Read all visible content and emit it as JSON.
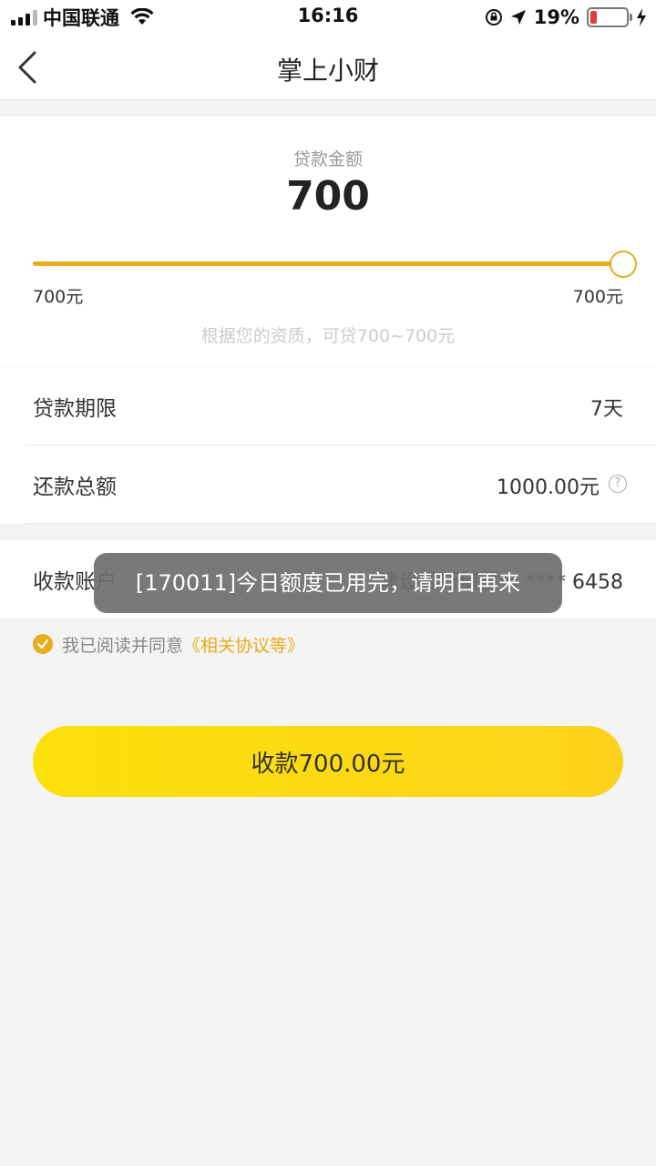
{
  "status_bar": {
    "carrier": "中国联通",
    "time": "16:16",
    "battery_percent": "19%",
    "battery_level": 0.19,
    "battery_color": "#e23b3b"
  },
  "nav": {
    "back_icon": "chevron-left-icon",
    "title": "掌上小财"
  },
  "loan": {
    "amount_label": "贷款金额",
    "amount_value": "700",
    "slider_min_label": "700元",
    "slider_max_label": "700元",
    "slider_fraction": 1.0,
    "quota_hint": "根据您的资质，可贷700~700元"
  },
  "term_row": {
    "label": "贷款期限",
    "value": "7天"
  },
  "total_row": {
    "label": "还款总额",
    "value": "1000.00元",
    "help_icon": "question-circle-icon",
    "help_glyph": "?"
  },
  "account_row": {
    "label": "收款账户",
    "value": "建设银行储蓄卡 **** 6458"
  },
  "agreement": {
    "check_icon": "check-circle-icon",
    "text": "我已阅读并同意",
    "link": "《相关协议等》"
  },
  "submit": {
    "label": "收款700.00元"
  },
  "toast": {
    "message": "[170011]今日额度已用完，请明日再来"
  },
  "colors": {
    "accent": "#e8ac1c",
    "button_start": "#fbe10b",
    "button_end": "#fcd21b",
    "background": "#f4f4f4"
  }
}
